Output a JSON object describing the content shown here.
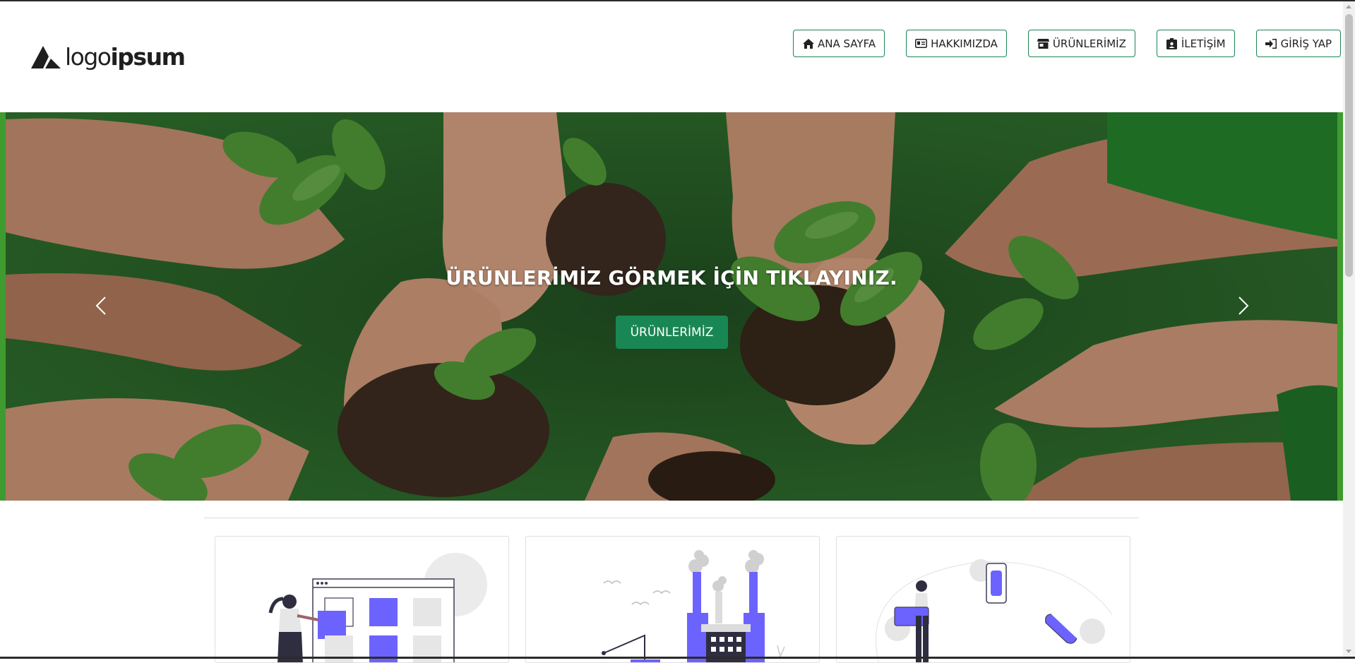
{
  "brand": {
    "logo_text_light": "logo",
    "logo_text_bold": "ipsum"
  },
  "nav": [
    {
      "label": "ANA SAYFA",
      "icon": "home-icon"
    },
    {
      "label": "HAKKIMIZDA",
      "icon": "id-card-icon"
    },
    {
      "label": "ÜRÜNLERİMİZ",
      "icon": "store-icon"
    },
    {
      "label": "İLETİŞİM",
      "icon": "contact-badge-icon"
    },
    {
      "label": "GİRİŞ YAP",
      "icon": "sign-in-icon"
    }
  ],
  "hero": {
    "caption": "ÜRÜNLERİMİZ GÖRMEK İÇİN TIKLAYINIZ.",
    "button_label": "ÜRÜNLERİMİZ",
    "prev_icon": "chevron-left-icon",
    "next_icon": "chevron-right-icon"
  },
  "cards": [
    {
      "illustration": "woman-with-blocks-illustration"
    },
    {
      "illustration": "factory-illustration"
    },
    {
      "illustration": "woman-with-phone-illustration"
    }
  ],
  "colors": {
    "accent": "#198754",
    "illustration": "#6c63ff"
  }
}
